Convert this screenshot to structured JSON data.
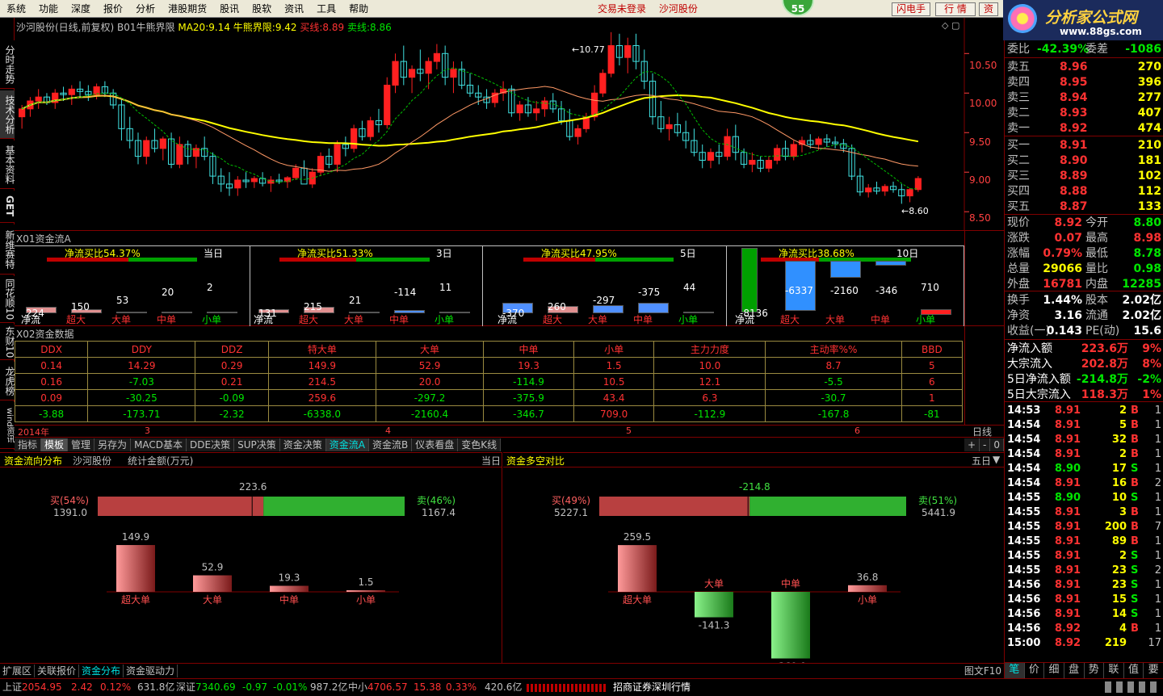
{
  "menu": {
    "items": [
      "系统",
      "功能",
      "深度",
      "报价",
      "分析",
      "港股期货",
      "股讯",
      "股软",
      "资讯",
      "工具",
      "帮助"
    ],
    "trade_status": "交易未登录",
    "stock_name": "沙河股份",
    "badge": "55",
    "buttons": [
      "闪电手",
      "行 情",
      "资"
    ]
  },
  "logo": {
    "title": "分析家公式网",
    "url": "www.88gs.com"
  },
  "left_tabs": [
    "分时走势",
    "技术分析",
    "基本资料",
    "GET",
    "新维赛特",
    "同花顺10",
    "东财10",
    "龙虎榜",
    "wind资讯"
  ],
  "chart_header": {
    "stock": "沙河股份(日线,前复权)",
    "indicator": "B01牛熊界限",
    "ma20_label": "MA20:",
    "ma20": "9.14",
    "bull_label": "牛熊界限:",
    "bull": "9.42",
    "buy_label": "买线:",
    "buy": "8.89",
    "sell_label": "卖线:",
    "sell": "8.86"
  },
  "price_axis": [
    "10.50",
    "10.00",
    "9.50",
    "9.00",
    "8.50"
  ],
  "price_annotations": {
    "high": "10.77",
    "low": "8.60"
  },
  "date_axis": {
    "year": "2014年",
    "months": [
      "3",
      "4",
      "5",
      "6"
    ]
  },
  "period_label": "日线",
  "chart_data": {
    "type": "candlestick",
    "title": "沙河股份(日线,前复权)",
    "ylim": [
      8.4,
      10.85
    ],
    "ohlc": [
      [
        9.7,
        9.85,
        9.55,
        9.8
      ],
      [
        9.8,
        9.95,
        9.7,
        9.9
      ],
      [
        9.9,
        10.05,
        9.8,
        9.95
      ],
      [
        9.95,
        10.0,
        9.85,
        9.88
      ],
      [
        9.88,
        10.05,
        9.8,
        10.0
      ],
      [
        10.0,
        10.08,
        9.9,
        9.98
      ],
      [
        9.98,
        10.1,
        9.85,
        10.05
      ],
      [
        10.05,
        10.15,
        9.95,
        10.02
      ],
      [
        10.02,
        10.1,
        9.9,
        9.98
      ],
      [
        9.98,
        10.12,
        9.92,
        10.08
      ],
      [
        10.08,
        10.15,
        9.95,
        10.0
      ],
      [
        10.0,
        10.05,
        9.8,
        9.85
      ],
      [
        9.85,
        9.92,
        9.4,
        9.55
      ],
      [
        9.55,
        9.7,
        9.3,
        9.4
      ],
      [
        9.4,
        9.5,
        9.1,
        9.2
      ],
      [
        9.2,
        9.45,
        9.1,
        9.4
      ],
      [
        9.4,
        9.55,
        9.25,
        9.3
      ],
      [
        9.3,
        9.45,
        9.15,
        9.42
      ],
      [
        9.42,
        9.5,
        9.05,
        9.1
      ],
      [
        9.1,
        9.45,
        9.05,
        9.35
      ],
      [
        9.35,
        9.4,
        9.1,
        9.2
      ],
      [
        9.2,
        9.35,
        9.05,
        9.3
      ],
      [
        9.3,
        9.45,
        9.15,
        9.2
      ],
      [
        9.2,
        9.25,
        8.85,
        8.95
      ],
      [
        8.95,
        9.05,
        8.75,
        8.85
      ],
      [
        8.85,
        9.0,
        8.7,
        8.8
      ],
      [
        8.8,
        8.95,
        8.7,
        8.9
      ],
      [
        8.9,
        9.0,
        8.8,
        8.88
      ],
      [
        8.88,
        8.95,
        8.8,
        8.92
      ],
      [
        8.92,
        9.0,
        8.82,
        8.86
      ],
      [
        8.86,
        8.95,
        8.75,
        8.9
      ],
      [
        8.9,
        8.98,
        8.85,
        8.88
      ],
      [
        8.88,
        8.95,
        8.8,
        8.93
      ],
      [
        8.93,
        9.1,
        8.9,
        9.05
      ],
      [
        9.05,
        9.15,
        8.95,
        8.85
      ],
      [
        8.85,
        9.05,
        8.8,
        9.0
      ],
      [
        9.0,
        9.25,
        8.95,
        9.2
      ],
      [
        9.2,
        9.3,
        9.05,
        9.1
      ],
      [
        9.1,
        9.4,
        9.0,
        9.35
      ],
      [
        9.35,
        9.45,
        9.2,
        9.3
      ],
      [
        9.3,
        9.6,
        9.25,
        9.55
      ],
      [
        9.55,
        9.65,
        9.4,
        9.45
      ],
      [
        9.45,
        9.7,
        9.4,
        9.65
      ],
      [
        9.65,
        9.8,
        9.5,
        9.6
      ],
      [
        9.6,
        10.2,
        9.55,
        10.1
      ],
      [
        10.1,
        10.5,
        10.0,
        10.4
      ],
      [
        10.4,
        10.6,
        10.1,
        10.2
      ],
      [
        10.2,
        10.35,
        10.0,
        10.3
      ],
      [
        10.3,
        10.55,
        10.15,
        10.25
      ],
      [
        10.25,
        10.45,
        10.05,
        10.4
      ],
      [
        10.4,
        10.62,
        10.3,
        10.5
      ],
      [
        10.5,
        10.6,
        10.1,
        10.2
      ],
      [
        10.2,
        10.4,
        10.0,
        10.3
      ],
      [
        10.3,
        10.4,
        10.05,
        10.1
      ],
      [
        10.1,
        10.25,
        9.95,
        10.0
      ],
      [
        10.0,
        10.1,
        9.85,
        9.95
      ],
      [
        9.95,
        10.05,
        9.8,
        9.88
      ],
      [
        9.88,
        10.05,
        9.82,
        10.0
      ],
      [
        10.0,
        10.15,
        9.9,
        10.05
      ],
      [
        10.05,
        10.1,
        9.7,
        9.75
      ],
      [
        9.75,
        9.9,
        9.65,
        9.85
      ],
      [
        9.85,
        9.95,
        9.7,
        9.75
      ],
      [
        9.75,
        9.9,
        9.65,
        9.8
      ],
      [
        9.8,
        9.95,
        9.7,
        9.9
      ],
      [
        9.9,
        10.0,
        9.75,
        9.8
      ],
      [
        9.8,
        9.9,
        9.6,
        9.65
      ],
      [
        9.65,
        9.8,
        9.4,
        9.45
      ],
      [
        9.45,
        9.6,
        9.35,
        9.55
      ],
      [
        9.55,
        9.75,
        9.5,
        9.7
      ],
      [
        9.7,
        10.1,
        9.65,
        10.0
      ],
      [
        10.0,
        10.3,
        9.95,
        10.25
      ],
      [
        10.25,
        10.77,
        10.2,
        10.6
      ],
      [
        10.6,
        10.75,
        10.35,
        10.45
      ],
      [
        10.45,
        10.7,
        10.25,
        10.6
      ],
      [
        10.6,
        10.75,
        10.3,
        10.4
      ],
      [
        10.4,
        10.55,
        10.05,
        10.15
      ],
      [
        10.15,
        10.25,
        9.6,
        9.7
      ],
      [
        9.7,
        9.9,
        9.5,
        9.55
      ],
      [
        9.55,
        9.7,
        9.4,
        9.6
      ],
      [
        9.6,
        9.75,
        9.45,
        9.5
      ],
      [
        9.5,
        9.65,
        9.3,
        9.4
      ],
      [
        9.4,
        9.55,
        9.2,
        9.25
      ],
      [
        9.25,
        9.35,
        9.05,
        9.15
      ],
      [
        9.15,
        9.3,
        9.05,
        9.25
      ],
      [
        9.25,
        9.35,
        9.1,
        9.2
      ],
      [
        9.2,
        9.55,
        9.15,
        9.45
      ],
      [
        9.45,
        9.6,
        9.15,
        9.25
      ],
      [
        9.25,
        9.3,
        9.05,
        9.1
      ],
      [
        9.1,
        9.25,
        9.0,
        9.15
      ],
      [
        9.15,
        9.2,
        9.0,
        9.05
      ],
      [
        9.05,
        9.2,
        9.0,
        9.15
      ],
      [
        9.15,
        9.35,
        9.1,
        9.3
      ],
      [
        9.3,
        9.4,
        9.15,
        9.2
      ],
      [
        9.2,
        9.4,
        9.15,
        9.35
      ],
      [
        9.35,
        9.45,
        9.25,
        9.4
      ],
      [
        9.4,
        9.48,
        9.3,
        9.35
      ],
      [
        9.35,
        9.45,
        9.28,
        9.42
      ],
      [
        9.42,
        9.48,
        9.32,
        9.38
      ],
      [
        9.38,
        9.45,
        9.3,
        9.36
      ],
      [
        9.36,
        9.42,
        9.25,
        9.3
      ],
      [
        9.3,
        9.35,
        8.9,
        8.95
      ],
      [
        8.95,
        9.05,
        8.7,
        8.75
      ],
      [
        8.75,
        8.85,
        8.68,
        8.8
      ],
      [
        8.8,
        8.88,
        8.72,
        8.76
      ],
      [
        8.76,
        8.85,
        8.7,
        8.82
      ],
      [
        8.82,
        8.88,
        8.74,
        8.78
      ],
      [
        8.78,
        8.85,
        8.6,
        8.7
      ],
      [
        8.7,
        8.8,
        8.62,
        8.78
      ],
      [
        8.78,
        8.95,
        8.75,
        8.92
      ]
    ],
    "series": [
      {
        "name": "MA20",
        "value": 9.14
      }
    ]
  },
  "fund_flow": {
    "title": "X01资金流A",
    "periods": [
      {
        "label": "当日",
        "ratio_label": "净流买比54.37%",
        "values": [
          "224",
          "150",
          "53",
          "20",
          "2"
        ]
      },
      {
        "label": "3日",
        "ratio_label": "净流买比51.33%",
        "values": [
          "131",
          "215",
          "21",
          "-114",
          "11"
        ]
      },
      {
        "label": "5日",
        "ratio_label": "净流买比47.95%",
        "values": [
          "-370",
          "260",
          "-297",
          "-375",
          "44"
        ]
      },
      {
        "label": "10日",
        "ratio_label": "净流买比38.68%",
        "values": [
          "-8136",
          "-6337",
          "-2160",
          "-346",
          "710"
        ]
      }
    ],
    "categories": [
      "净流",
      "超大",
      "大单",
      "中单",
      "小单"
    ]
  },
  "fund_data": {
    "title": "X02资金数据",
    "headers": [
      "DDX",
      "DDY",
      "DDZ",
      "特大单",
      "大单",
      "中单",
      "小单",
      "主力力度",
      "主动率%%",
      "BBD"
    ],
    "rows": [
      [
        "0.14",
        "14.29",
        "0.29",
        "149.9",
        "52.9",
        "19.3",
        "1.5",
        "10.0",
        "8.7",
        "5"
      ],
      [
        "0.16",
        "-7.03",
        "0.21",
        "214.5",
        "20.0",
        "-114.9",
        "10.5",
        "12.1",
        "-5.5",
        "6"
      ],
      [
        "0.09",
        "-30.25",
        "-0.09",
        "259.6",
        "-297.2",
        "-375.9",
        "43.4",
        "6.3",
        "-30.7",
        "1"
      ],
      [
        "-3.88",
        "-173.71",
        "-2.32",
        "-6338.0",
        "-2160.4",
        "-346.7",
        "709.0",
        "-112.9",
        "-167.8",
        "-81"
      ]
    ]
  },
  "tabs": [
    "指标",
    "模板",
    "管理",
    "另存为",
    "MACD基本",
    "DDE决策",
    "SUP决策",
    "资金决策",
    "资金流A",
    "资金流B",
    "仪表看盘",
    "变色K线"
  ],
  "tabs_right": [
    "+",
    "-",
    "0"
  ],
  "flow_dist": {
    "title": "资金流向分布",
    "stock": "沙河股份",
    "unit": "统计金额(万元)",
    "period": "当日",
    "net": "223.6",
    "buy_label": "买(54%)",
    "buy_value": "1391.0",
    "buy_pct": 54,
    "sell_label": "卖(46%)",
    "sell_value": "1167.4",
    "bars": [
      {
        "label": "超大单",
        "value": 149.9,
        "text": "149.9"
      },
      {
        "label": "大单",
        "value": 52.9,
        "text": "52.9"
      },
      {
        "label": "中单",
        "value": 19.3,
        "text": "19.3"
      },
      {
        "label": "小单",
        "value": 1.5,
        "text": "1.5"
      }
    ]
  },
  "flow_compare": {
    "title": "资金多空对比",
    "period": "五日",
    "net": "-214.8",
    "buy_label": "买(49%)",
    "buy_value": "5227.1",
    "buy_pct": 49,
    "sell_label": "卖(51%)",
    "sell_value": "5441.9",
    "bars": [
      {
        "label": "超大单",
        "value": 259.5,
        "text": "259.5"
      },
      {
        "label": "大单",
        "value": -141.3,
        "text": "-141.3"
      },
      {
        "label": "中单",
        "value": -369.9,
        "text": "-369.9"
      },
      {
        "label": "小单",
        "value": 36.8,
        "text": "36.8"
      }
    ]
  },
  "bottom_tabs": [
    "扩展区",
    "关联报价",
    "资金分布",
    "资金驱动力"
  ],
  "bottom_right": "图文F10",
  "quote": {
    "wei": {
      "label": "委比",
      "value": "-42.39%",
      "label2": "委差",
      "value2": "-1086"
    },
    "asks": [
      {
        "label": "卖五",
        "price": "8.96",
        "vol": "270"
      },
      {
        "label": "卖四",
        "price": "8.95",
        "vol": "396"
      },
      {
        "label": "卖三",
        "price": "8.94",
        "vol": "277"
      },
      {
        "label": "卖二",
        "price": "8.93",
        "vol": "407"
      },
      {
        "label": "卖一",
        "price": "8.92",
        "vol": "474"
      }
    ],
    "bids": [
      {
        "label": "买一",
        "price": "8.91",
        "vol": "210"
      },
      {
        "label": "买二",
        "price": "8.90",
        "vol": "181"
      },
      {
        "label": "买三",
        "price": "8.89",
        "vol": "102"
      },
      {
        "label": "买四",
        "price": "8.88",
        "vol": "112"
      },
      {
        "label": "买五",
        "price": "8.87",
        "vol": "133"
      }
    ],
    "stats": [
      {
        "l1": "现价",
        "v1": "8.92",
        "c1": "#ff3232",
        "l2": "今开",
        "v2": "8.80",
        "c2": "#00e600"
      },
      {
        "l1": "涨跌",
        "v1": "0.07",
        "c1": "#ff3232",
        "l2": "最高",
        "v2": "8.98",
        "c2": "#ff3232"
      },
      {
        "l1": "涨幅",
        "v1": "0.79%",
        "c1": "#ff3232",
        "l2": "最低",
        "v2": "8.78",
        "c2": "#00e600"
      },
      {
        "l1": "总量",
        "v1": "29066",
        "c1": "#ffff00",
        "l2": "量比",
        "v2": "0.98",
        "c2": "#00e600"
      },
      {
        "l1": "外盘",
        "v1": "16781",
        "c1": "#ff3232",
        "l2": "内盘",
        "v2": "12285",
        "c2": "#00e600"
      }
    ],
    "stats2": [
      {
        "l1": "换手",
        "v1": "1.44%",
        "c1": "#ffffff",
        "l2": "股本",
        "v2": "2.02亿",
        "c2": "#ffffff"
      },
      {
        "l1": "净资",
        "v1": "3.16",
        "c1": "#ffffff",
        "l2": "流通",
        "v2": "2.02亿",
        "c2": "#ffffff"
      },
      {
        "l1": "收益(一)",
        "v1": "0.143",
        "c1": "#ffffff",
        "l2": "PE(动)",
        "v2": "15.6",
        "c2": "#ffffff"
      }
    ],
    "flows": [
      {
        "l": "净流入额",
        "v": "223.6万",
        "p": "9%",
        "c": "#ff3232"
      },
      {
        "l": "大宗流入",
        "v": "202.8万",
        "p": "8%",
        "c": "#ff3232"
      },
      {
        "l": "5日净流入额",
        "v": "-214.8万",
        "p": "-2%",
        "c": "#00e600"
      },
      {
        "l": "5日大宗流入",
        "v": "118.3万",
        "p": "1%",
        "c": "#ff3232"
      }
    ],
    "ticks": [
      {
        "t": "14:53",
        "p": "8.91",
        "v": "2",
        "s": "B",
        "n": "1"
      },
      {
        "t": "14:54",
        "p": "8.91",
        "v": "5",
        "s": "B",
        "n": "1"
      },
      {
        "t": "14:54",
        "p": "8.91",
        "v": "32",
        "s": "B",
        "n": "1"
      },
      {
        "t": "14:54",
        "p": "8.91",
        "v": "2",
        "s": "B",
        "n": "1"
      },
      {
        "t": "14:54",
        "p": "8.90",
        "v": "17",
        "s": "S",
        "n": "1"
      },
      {
        "t": "14:54",
        "p": "8.91",
        "v": "16",
        "s": "B",
        "n": "2"
      },
      {
        "t": "14:55",
        "p": "8.90",
        "v": "10",
        "s": "S",
        "n": "1"
      },
      {
        "t": "14:55",
        "p": "8.91",
        "v": "3",
        "s": "B",
        "n": "1"
      },
      {
        "t": "14:55",
        "p": "8.91",
        "v": "200",
        "s": "B",
        "n": "7"
      },
      {
        "t": "14:55",
        "p": "8.91",
        "v": "89",
        "s": "B",
        "n": "1"
      },
      {
        "t": "14:55",
        "p": "8.91",
        "v": "2",
        "s": "S",
        "n": "1"
      },
      {
        "t": "14:55",
        "p": "8.91",
        "v": "23",
        "s": "S",
        "n": "2"
      },
      {
        "t": "14:56",
        "p": "8.91",
        "v": "23",
        "s": "S",
        "n": "1"
      },
      {
        "t": "14:56",
        "p": "8.91",
        "v": "15",
        "s": "S",
        "n": "1"
      },
      {
        "t": "14:56",
        "p": "8.91",
        "v": "14",
        "s": "S",
        "n": "1"
      },
      {
        "t": "14:56",
        "p": "8.92",
        "v": "4",
        "s": "B",
        "n": "1"
      },
      {
        "t": "15:00",
        "p": "8.92",
        "v": "219",
        "s": "",
        "n": "17"
      }
    ],
    "bottom_tabs": [
      "笔",
      "价",
      "细",
      "盘",
      "势",
      "联",
      "值",
      "要"
    ]
  },
  "status": {
    "sh_label": "上证",
    "sh": "2054.95",
    "sh_chg": "2.42",
    "sh_pct": "0.12%",
    "sh_amt": "631.8亿",
    "sz_label": "深证",
    "sz": "7340.69",
    "sz_chg": "-0.97",
    "sz_pct": "-0.01%",
    "sz_amt": "987.2亿",
    "zx_label": "中小",
    "zx": "4706.57",
    "zx_chg": "15.38",
    "zx_pct": "0.33%",
    "zx_amt": "420.6亿",
    "broker": "招商证券深圳行情"
  }
}
